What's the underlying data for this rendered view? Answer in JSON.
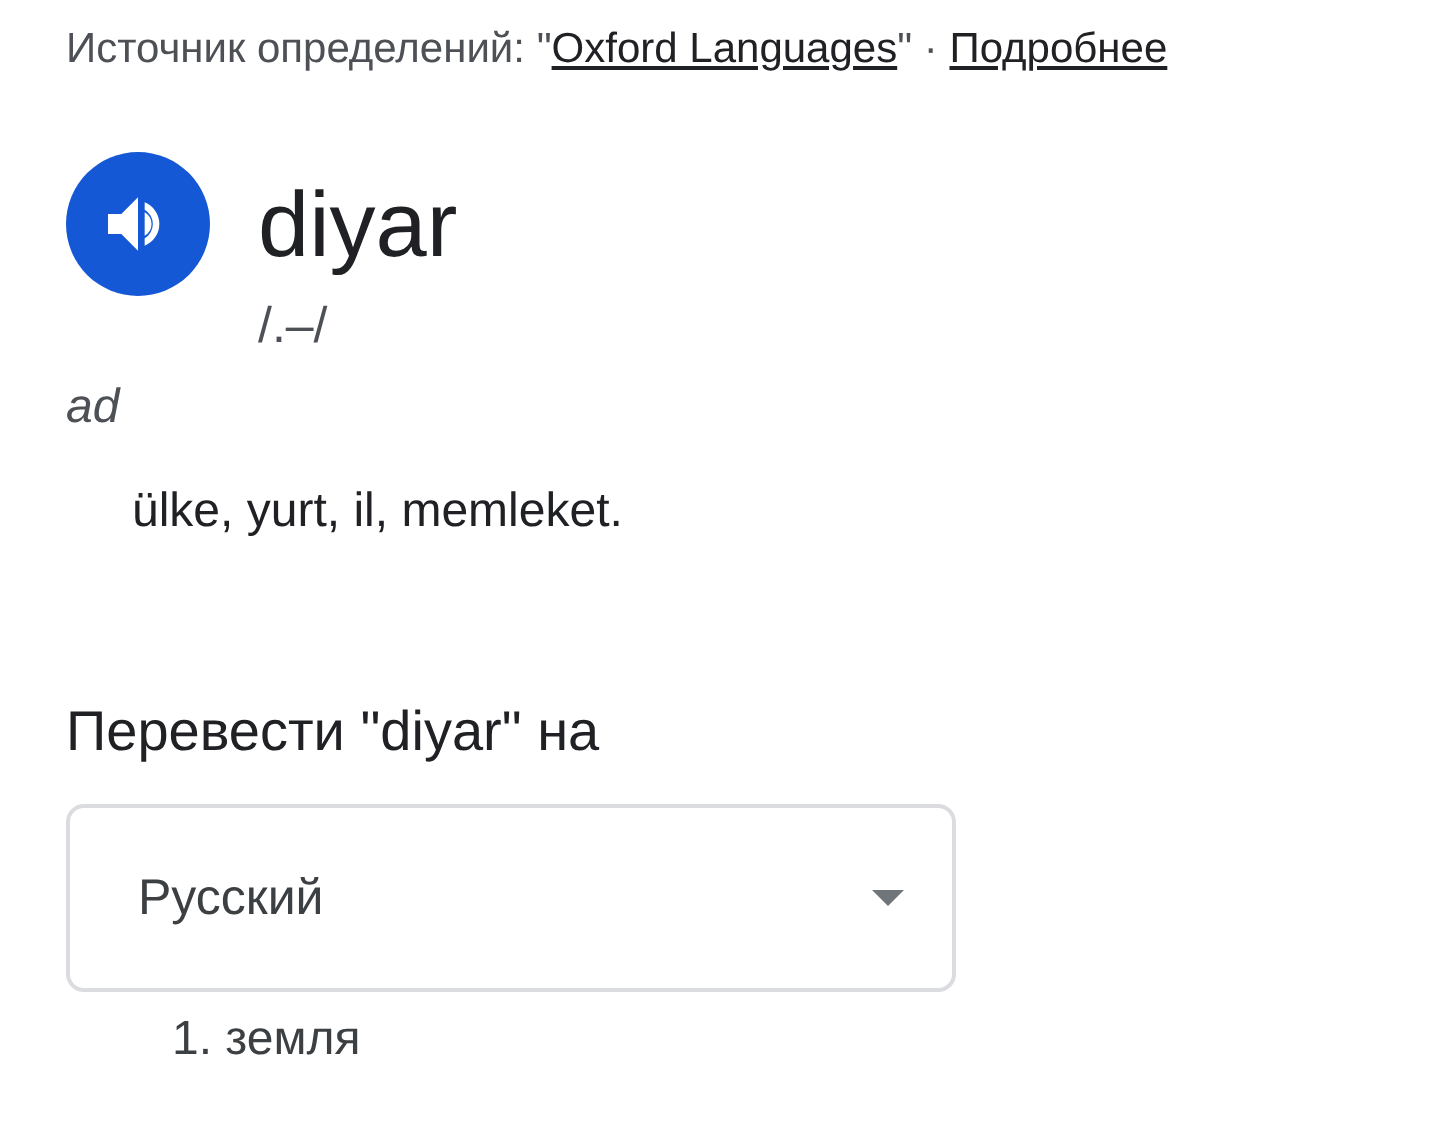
{
  "source": {
    "prefix": "Источник определений: \"",
    "link": "Oxford Languages",
    "suffix": "\" ·",
    "more": "Подробнее"
  },
  "entry": {
    "word": "diyar",
    "phonetic": "/.–/",
    "part_of_speech": "ad",
    "definition": "ülke, yurt, il, memleket."
  },
  "translate": {
    "heading": "Перевести \"diyar\" на",
    "language": "Русский",
    "results": [
      "1. земля"
    ]
  }
}
